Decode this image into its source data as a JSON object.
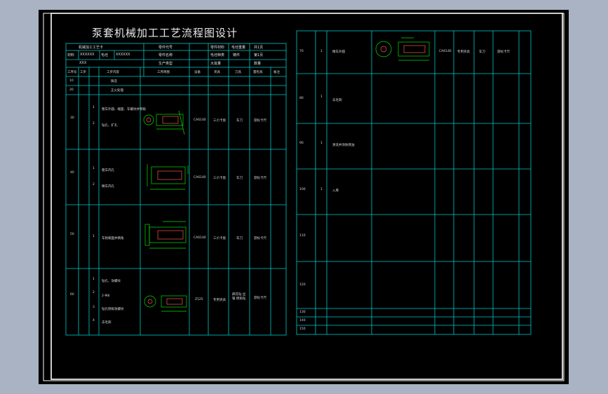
{
  "title": "泵套机械加工工艺流程图设计",
  "header": {
    "r1": [
      "机械加工工艺卡",
      "零件代号",
      "零件材料",
      "毛坯重量",
      "共1页"
    ],
    "r2": [
      "材料",
      "XXXXXX",
      "毛坯",
      "XXXXXX",
      "零件名称",
      "毛坯种类",
      "铸件",
      "第1页"
    ],
    "r3": [
      "XXX",
      "生产类型",
      "大批量",
      "数量"
    ],
    "cols": [
      "工序号",
      "工步",
      "工步内容",
      "工序简图",
      "设备",
      "夹具",
      "刀具",
      "量检具",
      "备注"
    ]
  },
  "left_rows": [
    {
      "no": "10",
      "steps": [
        {
          "n": "",
          "text": "铸造"
        }
      ]
    },
    {
      "no": "20",
      "steps": [
        {
          "n": "",
          "text": "正火处理"
        }
      ]
    },
    {
      "no": "30",
      "steps": [
        {
          "n": "1",
          "text": "粗车外圆、端面、车螺纹并倒角"
        },
        {
          "n": "2",
          "text": "钻孔、扩孔"
        }
      ],
      "equip": "CA6140",
      "fixture": "三爪卡盘",
      "tool": "车刀",
      "gauge": "游标卡尺"
    },
    {
      "no": "40",
      "steps": [
        {
          "n": "1",
          "text": "粗车内孔"
        },
        {
          "n": "2",
          "text": "精车内孔"
        }
      ],
      "equip": "CA6140",
      "fixture": "三爪卡盘",
      "tool": "车刀",
      "gauge": "游标卡尺"
    },
    {
      "no": "50",
      "steps": [
        {
          "n": "1",
          "text": "车削端面并倒角"
        }
      ],
      "equip": "CA6140",
      "fixture": "三爪卡盘",
      "tool": "车刀",
      "gauge": "游标卡尺"
    },
    {
      "no": "60",
      "steps": [
        {
          "n": "1",
          "text": "钻孔、攻螺纹"
        },
        {
          "n": "2",
          "text": "2-M8"
        },
        {
          "n": "3",
          "text": "钻孔倒角攻螺纹"
        },
        {
          "n": "4",
          "text": "去毛刺"
        }
      ],
      "equip": "Z525",
      "fixture": "专用夹具",
      "tool": "麻花钻 丝锥 倒角钻",
      "gauge": "游标卡尺"
    }
  ],
  "right_rows": [
    {
      "no": "70",
      "step": "1",
      "text": "精车外圆",
      "equip": "CA6140",
      "fixture": "专用夹具",
      "tool": "车刀",
      "gauge": "游标卡尺"
    },
    {
      "no": "80",
      "step": "1",
      "text": "去毛刺"
    },
    {
      "no": "90",
      "step": "1",
      "text": "清洗并涂防锈油"
    },
    {
      "no": "100",
      "step": "1",
      "text": "入库"
    },
    {
      "no": "110"
    },
    {
      "no": "120"
    },
    {
      "no": "130"
    },
    {
      "no": "140"
    },
    {
      "no": "150"
    }
  ],
  "colors": {
    "frame": "#ffffff",
    "grid": "#00c8c8",
    "drawing": "#00e000",
    "part": "#ff5050"
  }
}
